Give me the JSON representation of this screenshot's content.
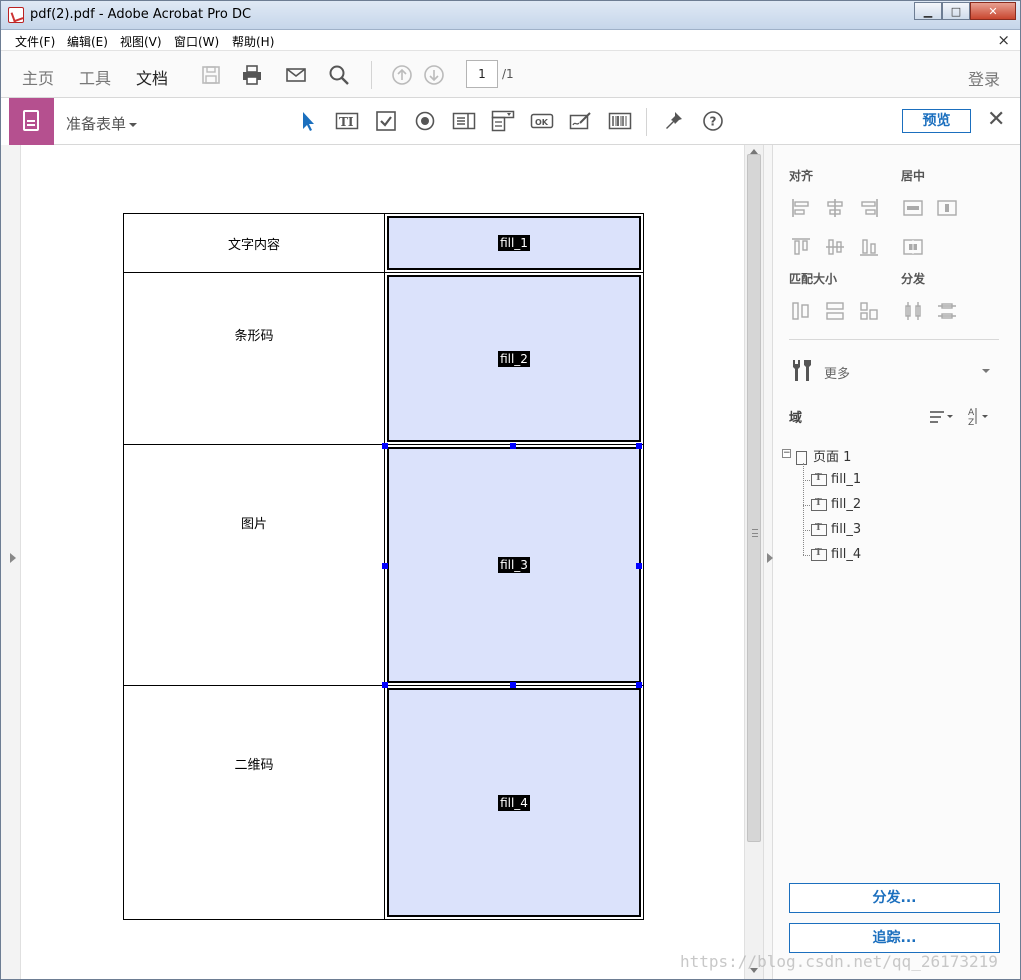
{
  "window": {
    "title": "pdf(2).pdf - Adobe Acrobat Pro DC",
    "minimize_glyph": "▁",
    "maximize_glyph": "□",
    "close_glyph": "✕"
  },
  "menubar": {
    "items": [
      "文件(F)",
      "编辑(E)",
      "视图(V)",
      "窗口(W)",
      "帮助(H)"
    ],
    "close_glyph": "×"
  },
  "toolbar": {
    "tabs": [
      "主页",
      "工具",
      "文档"
    ],
    "active_tab": "文档",
    "current_page": "1",
    "total_pages": "/1",
    "signin": "登录",
    "icons": [
      "save-icon",
      "print-icon",
      "email-icon",
      "search-icon",
      "page-up-icon",
      "page-down-icon"
    ]
  },
  "formbar": {
    "title": "准备表单",
    "preview_label": "预览",
    "close_glyph": "✕",
    "tools": [
      "select-cursor-icon",
      "text-field-icon",
      "checkbox-icon",
      "radio-button-icon",
      "list-box-icon",
      "dropdown-icon",
      "button-icon",
      "signature-icon",
      "barcode-icon",
      "pin-icon",
      "help-icon"
    ]
  },
  "document": {
    "rows": [
      {
        "label": "文字内容",
        "field": "fill_1"
      },
      {
        "label": "条形码",
        "field": "fill_2"
      },
      {
        "label": "图片",
        "field": "fill_3"
      },
      {
        "label": "二维码",
        "field": "fill_4"
      }
    ],
    "selected_field": "fill_3"
  },
  "right_panel": {
    "align_heading": "对齐",
    "center_heading": "居中",
    "match_size_heading": "匹配大小",
    "distribute_heading": "分发",
    "more_label": "更多",
    "fields_label": "域",
    "tree": {
      "page": "页面 1",
      "expander": "−",
      "fields": [
        "fill_1",
        "fill_2",
        "fill_3",
        "fill_4"
      ]
    },
    "distribute_button": "分发...",
    "track_button": "追踪..."
  },
  "watermark": "https://blog.csdn.net/qq_26173219",
  "colors": {
    "accent": "#1b6fbe",
    "form_badge": "#b5508f",
    "field_fill": "#dbe2fb",
    "handle": "#0000ff"
  }
}
